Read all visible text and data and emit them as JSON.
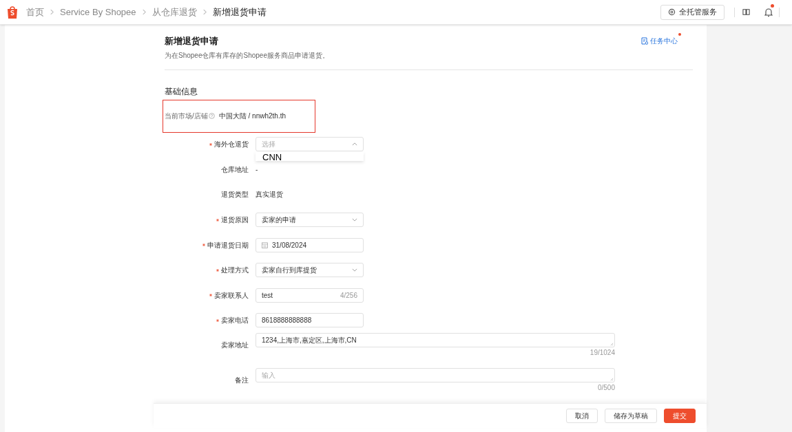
{
  "breadcrumb": [
    {
      "label": "首页",
      "current": false
    },
    {
      "label": "Service By Shopee",
      "current": false
    },
    {
      "label": "从仓库退货",
      "current": false
    },
    {
      "label": "新增退货申请",
      "current": true
    }
  ],
  "topbar": {
    "service_button": "全托管服务",
    "notification_badge": true
  },
  "header": {
    "title": "新增退货申请",
    "subtitle": "为在Shopee仓库有库存的Shopee服务商品申请退货。",
    "task_center": "任务中心",
    "task_badge": true
  },
  "section_title": "基础信息",
  "market": {
    "label": "当前市场/店铺",
    "value": "中国大陆 / nnwh2th.th"
  },
  "fields": [
    {
      "kind": "select",
      "label": "海外仓退货",
      "required": true,
      "placeholder": "选择",
      "expanded": true,
      "options": [
        "CNN"
      ]
    },
    {
      "kind": "static",
      "label": "仓库地址",
      "required": false,
      "value": "-"
    },
    {
      "kind": "static",
      "label": "退货类型",
      "required": false,
      "value": "真实退货"
    },
    {
      "kind": "select",
      "label": "退货原因",
      "required": true,
      "value": "卖家的申请",
      "expanded": false
    },
    {
      "kind": "date",
      "label": "申请退货日期",
      "required": true,
      "value": "31/08/2024"
    },
    {
      "kind": "select",
      "label": "处理方式",
      "required": true,
      "value": "卖家自行到库提货",
      "expanded": false
    },
    {
      "kind": "text",
      "label": "卖家联系人",
      "required": true,
      "value": "test",
      "counter": "4/256"
    },
    {
      "kind": "text",
      "label": "卖家电话",
      "required": true,
      "value": "8618888888888"
    },
    {
      "kind": "textarea",
      "label": "卖家地址",
      "required": false,
      "value": "1234,上海市,嘉定区,上海市,CN",
      "counter": "19/1024"
    },
    {
      "kind": "textarea",
      "label": "备注",
      "required": false,
      "placeholder": "输入",
      "counter": "0/500"
    }
  ],
  "footer_buttons": [
    {
      "label": "取消",
      "kind": "default"
    },
    {
      "label": "储存为草稿",
      "kind": "default"
    },
    {
      "label": "提交",
      "kind": "primary"
    }
  ]
}
